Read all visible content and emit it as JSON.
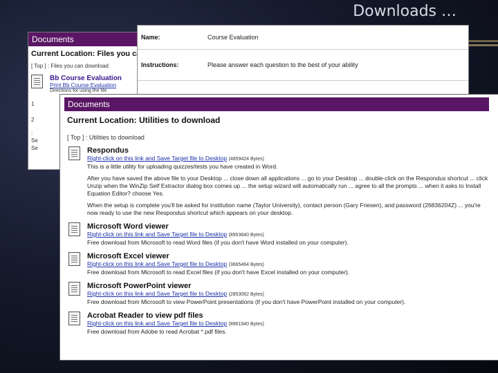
{
  "slide": {
    "title": "Downloads …"
  },
  "back_window": {
    "header": "Documents",
    "location": "Current Location: Files you ca",
    "path": "[ Top ] : Files you can download",
    "item_title": "Bb Course Evaluation",
    "item_link": "Print Bb Course Evaluation",
    "item_dir": "Directions for using the file",
    "fragments": [
      "1",
      "2",
      ":",
      "Se",
      "Se"
    ]
  },
  "form_window": {
    "rows": [
      {
        "label": "Name:",
        "value": "Course Evaluation"
      },
      {
        "label": "Instructions:",
        "value": "Please answer each question to the best of your ability"
      }
    ]
  },
  "front_window": {
    "header": "Documents",
    "location": "Current Location: Utilities to download",
    "path": "[ Top ] : Utilities to download",
    "entries": [
      {
        "title": "Respondus",
        "link": "Right-click on this link and Save Target file to Desktop",
        "size": "(4859424 Bytes)",
        "desc": "This is a little utility for uploading quizzes/tests you have created in Word.",
        "para1": "After you have saved the above file to your Desktop ... close down all applications ... go to your Desktop ... double-click on the Respondus shortcut ... click Unzip when the WinZip Self Extractor dialog box comes up ... the setup wizard will automatically run ... agree to all the prompts ... when it asks to Install Equation Editor? choose Yes.",
        "para2": "When the setup is complete you'll be asked for institution name (Taylor University), contact person (Gary Friesen), and password (26836204Z) ... you're now ready to use the new Respondus shortcut which appears on your desktop."
      },
      {
        "title": "Microsoft Word viewer",
        "link": "Right-click on this link and Save Target file to Desktop",
        "size": "(8953840 Bytes)",
        "desc": "Free download from Microsoft to read Word files (if you don't have Word installed on your computer)."
      },
      {
        "title": "Microsoft Excel viewer",
        "link": "Right-click on this link and Save Target file to Desktop",
        "size": "(3665464 Bytes)",
        "desc": "Free download from Microsoft to read Excel files (if you don't have Excel installed on your computer)."
      },
      {
        "title": "Microsoft PowerPoint viewer",
        "link": "Right-click on this link and Save Target file to Desktop",
        "size": "(2853062 Bytes)",
        "desc": "Free download from Microsoft to view PowerPoint presentations (if you don't have PowerPoint installed on your computer)."
      },
      {
        "title": "Acrobat Reader to view pdf files",
        "link": "Right-click on this link and Save Target file to Desktop",
        "size": "(8961940 Bytes)",
        "desc": "Free download from Adobe to read Acrobat *.pdf files."
      }
    ]
  }
}
